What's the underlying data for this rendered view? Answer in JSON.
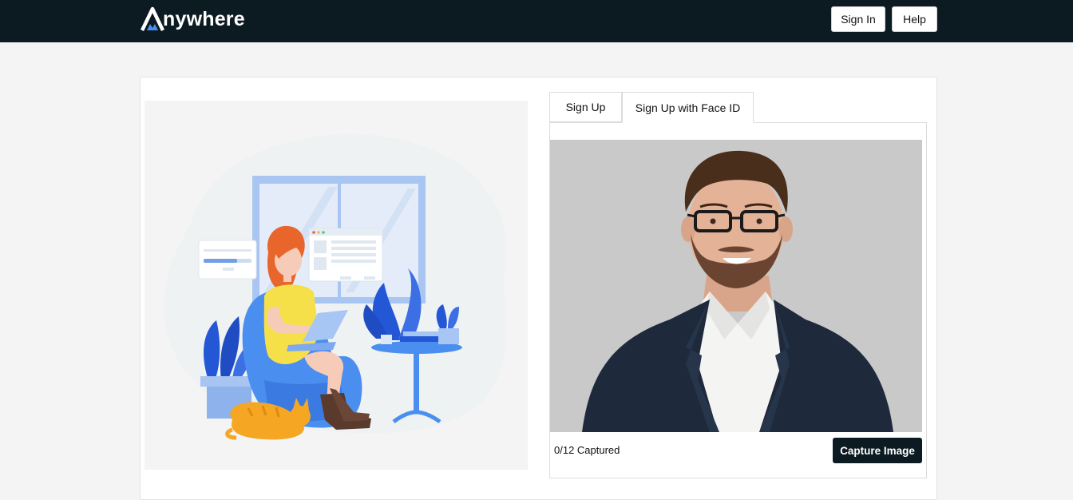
{
  "brand": {
    "name": "nywhere",
    "logo_icon": "mountain-a-icon"
  },
  "nav": {
    "sign_in": "Sign In",
    "help": "Help"
  },
  "tabs": [
    {
      "label": "Sign Up",
      "active": false
    },
    {
      "label": "Sign Up with Face ID",
      "active": true
    }
  ],
  "capture": {
    "status": "0/12 Captured",
    "button": "Capture Image"
  },
  "colors": {
    "navbar": "#0c1a21",
    "accent_blue": "#4a8ff0",
    "page_bg": "#f4f4f4"
  }
}
